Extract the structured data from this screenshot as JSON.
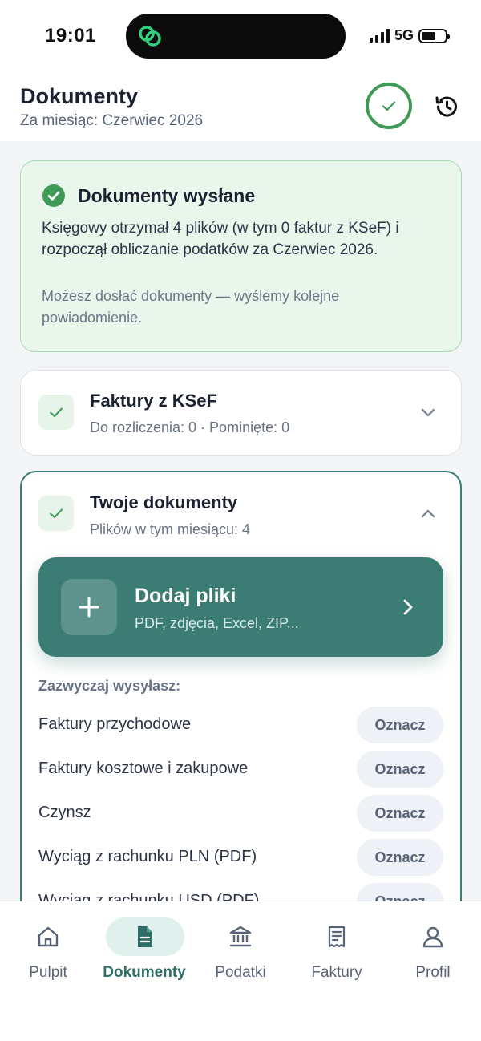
{
  "status_bar": {
    "time": "19:01",
    "network": "5G",
    "battery_level": 0.6
  },
  "header": {
    "title": "Dokumenty",
    "subtitle": "Za miesiąc: Czerwiec 2026",
    "status_icon": "check-icon",
    "history_icon": "history-icon"
  },
  "sent_card": {
    "title": "Dokumenty wysłane",
    "body": "Księgowy otrzymał 4 plików (w tym 0 faktur z KSeF) i rozpoczął obliczanie podatków za Czerwiec 2026.",
    "note": "Możesz dosłać dokumenty — wyślemy kolejne powiadomienie."
  },
  "ksef_card": {
    "title": "Faktury z KSeF",
    "subtitle": "Do rozliczenia: 0 · Pominięte: 0"
  },
  "docs_card": {
    "title": "Twoje dokumenty",
    "subtitle": "Plików w tym miesiącu: 4",
    "add_button": {
      "title": "Dodaj pliki",
      "subtitle": "PDF, zdjęcia, Excel, ZIP..."
    },
    "usual_label": "Zazwyczaj wysyłasz:",
    "items": [
      {
        "label": "Faktury przychodowe",
        "action": "Oznacz"
      },
      {
        "label": "Faktury kosztowe i zakupowe",
        "action": "Oznacz"
      },
      {
        "label": "Czynsz",
        "action": "Oznacz"
      },
      {
        "label": "Wyciąg z rachunku PLN (PDF)",
        "action": "Oznacz"
      },
      {
        "label": "Wyciąg z rachunku USD (PDF)",
        "action": "Oznacz"
      }
    ]
  },
  "bottom_nav": {
    "items": [
      {
        "label": "Pulpit",
        "icon": "home-icon"
      },
      {
        "label": "Dokumenty",
        "icon": "document-icon",
        "active": true
      },
      {
        "label": "Podatki",
        "icon": "bank-icon"
      },
      {
        "label": "Faktury",
        "icon": "receipt-icon"
      },
      {
        "label": "Profil",
        "icon": "user-icon"
      }
    ]
  },
  "colors": {
    "accent": "#3b7c74",
    "success": "#3e9a55",
    "success_bg": "#e9f6ec"
  }
}
